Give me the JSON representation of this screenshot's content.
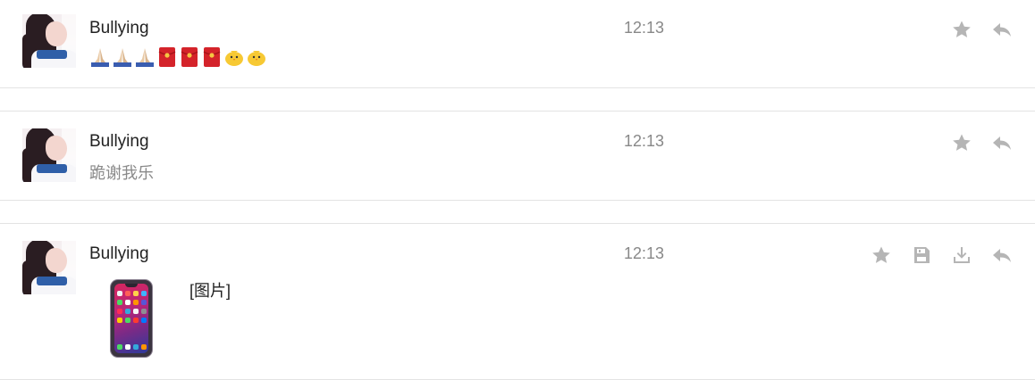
{
  "messages": [
    {
      "sender": "Bullying",
      "time": "12:13",
      "content_type": "emoji",
      "emojis": [
        "pray",
        "pray",
        "pray",
        "red-envelope",
        "red-envelope",
        "red-envelope",
        "chick",
        "chick"
      ],
      "actions": [
        "star-icon",
        "reply-icon"
      ]
    },
    {
      "sender": "Bullying",
      "time": "12:13",
      "content_type": "text",
      "text": "跪谢我乐",
      "actions": [
        "star-icon",
        "reply-icon"
      ]
    },
    {
      "sender": "Bullying",
      "time": "12:13",
      "content_type": "image",
      "image_label": "[图片]",
      "actions": [
        "star-icon",
        "save-icon",
        "download-icon",
        "reply-icon"
      ]
    }
  ],
  "colors": {
    "icon": "#b5b5b5",
    "time": "#888888",
    "text": "#8a8a8a",
    "divider": "#e3e3e3"
  }
}
